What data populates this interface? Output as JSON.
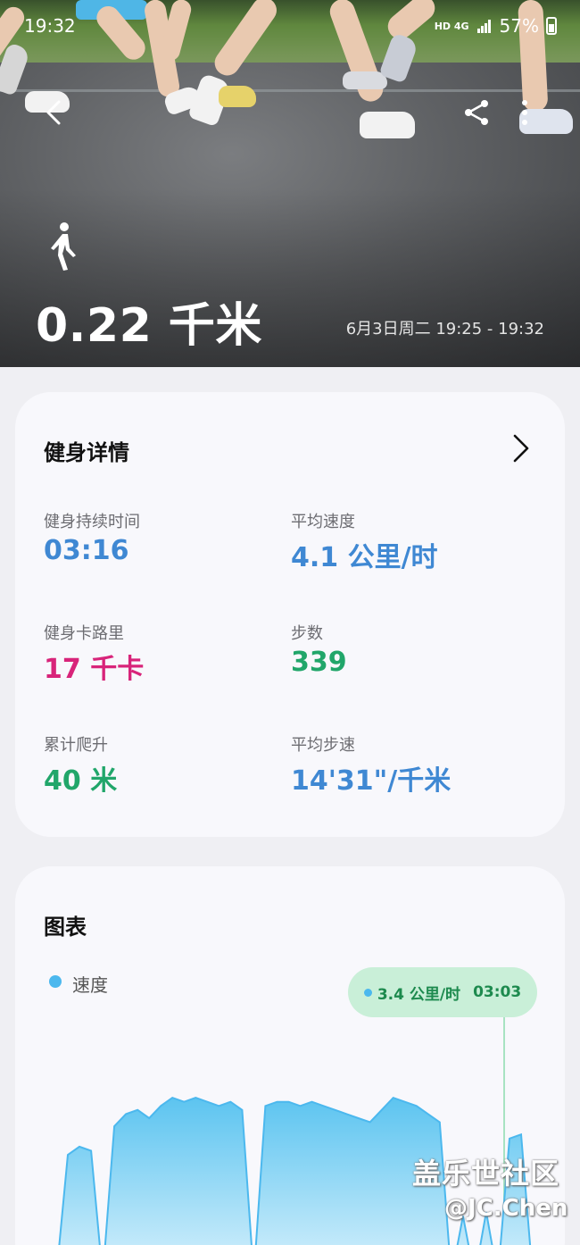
{
  "status_bar": {
    "time": "19:32",
    "indicators": "HD 4G",
    "battery": "57%"
  },
  "hero": {
    "distance": "0.22 千米",
    "date_range": "6月3日周二 19:25 - 19:32",
    "activity_icon": "walk-icon"
  },
  "details": {
    "title": "健身详情",
    "metrics": [
      {
        "label": "健身持续时间",
        "value": "03:16",
        "color": "#3f88d3"
      },
      {
        "label": "平均速度",
        "value": "4.1 公里/时",
        "color": "#3f88d3"
      },
      {
        "label": "健身卡路里",
        "value": "17 千卡",
        "color": "#d8247a"
      },
      {
        "label": "步数",
        "value": "339",
        "color": "#21a66a"
      },
      {
        "label": "累计爬升",
        "value": "40 米",
        "color": "#21a66a"
      },
      {
        "label": "平均步速",
        "value": "14'31\"/千米",
        "color": "#3f88d3"
      }
    ]
  },
  "chart": {
    "title": "图表",
    "legend": "速度",
    "tooltip_value": "3.4 公里/时",
    "tooltip_time": "03:03"
  },
  "chart_data": {
    "type": "area",
    "series": [
      {
        "name": "速度",
        "color": "#4cb8ee",
        "values": [
          0,
          3.0,
          3.2,
          3.1,
          0,
          3.7,
          4.0,
          4.1,
          3.9,
          4.2,
          4.4,
          4.3,
          4.4,
          4.3,
          4.2,
          4.3,
          4.1,
          0,
          4.2,
          4.3,
          4.3,
          4.2,
          4.3,
          4.2,
          4.1,
          4.0,
          3.9,
          3.8,
          4.1,
          4.4,
          4.3,
          4.2,
          4.0,
          3.8,
          0,
          1.5,
          0,
          1.6,
          0,
          3.4,
          3.5,
          0
        ]
      }
    ]
  },
  "watermark": {
    "line1": "盖乐世社区",
    "line2": "@JC.Chen"
  }
}
